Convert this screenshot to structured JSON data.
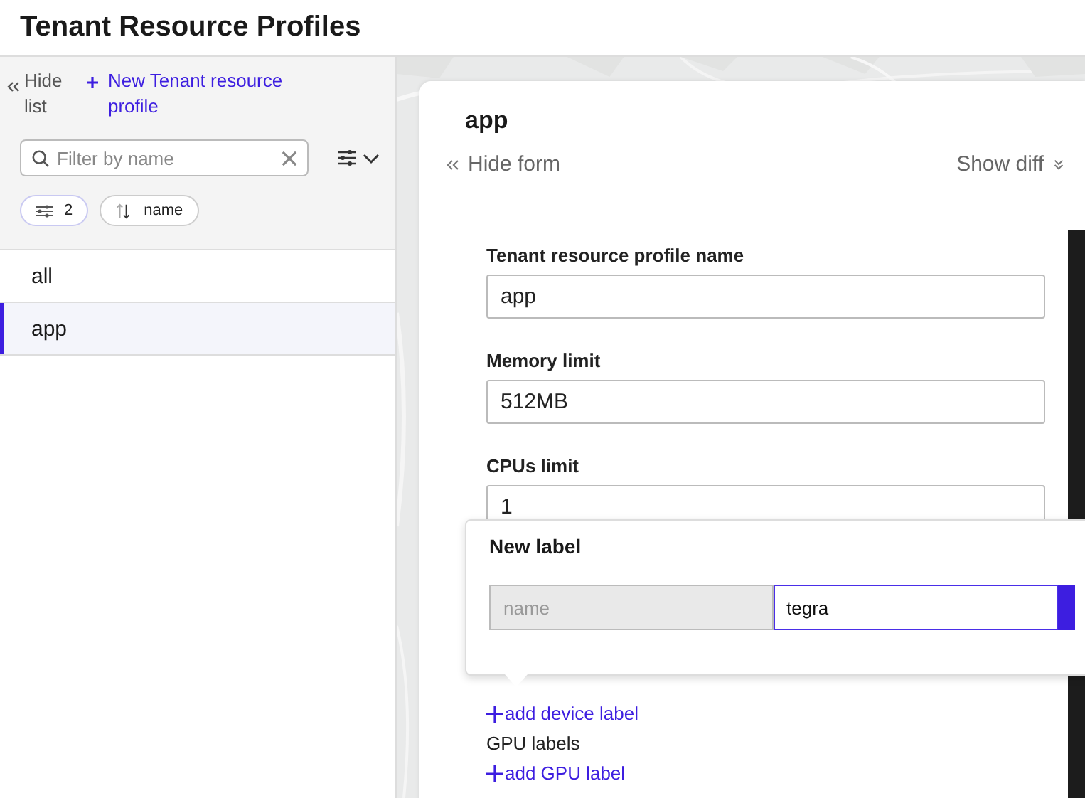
{
  "header": {
    "title": "Tenant Resource Profiles"
  },
  "sidebar": {
    "hide_list": "Hide list",
    "new_button": "New Tenant resource profile",
    "filter": {
      "placeholder": "Filter by name"
    },
    "chips": [
      {
        "kind": "filter",
        "label": "2"
      },
      {
        "kind": "sort",
        "label": "name"
      }
    ],
    "items": [
      {
        "label": "all",
        "selected": false
      },
      {
        "label": "app",
        "selected": true
      }
    ]
  },
  "form": {
    "title": "app",
    "hide_form": "Hide form",
    "show_diff": "Show diff",
    "fields": [
      {
        "label": "Tenant resource profile name",
        "value": "app"
      },
      {
        "label": "Memory limit",
        "value": "512MB"
      },
      {
        "label": "CPUs limit",
        "value": "1"
      }
    ],
    "label_groups": [
      {
        "add": "add device label"
      },
      {
        "label": "GPU labels",
        "add": "add GPU label"
      }
    ]
  },
  "popover": {
    "title": "New label",
    "key": {
      "placeholder": "name"
    },
    "value": {
      "value": "tegra"
    }
  }
}
